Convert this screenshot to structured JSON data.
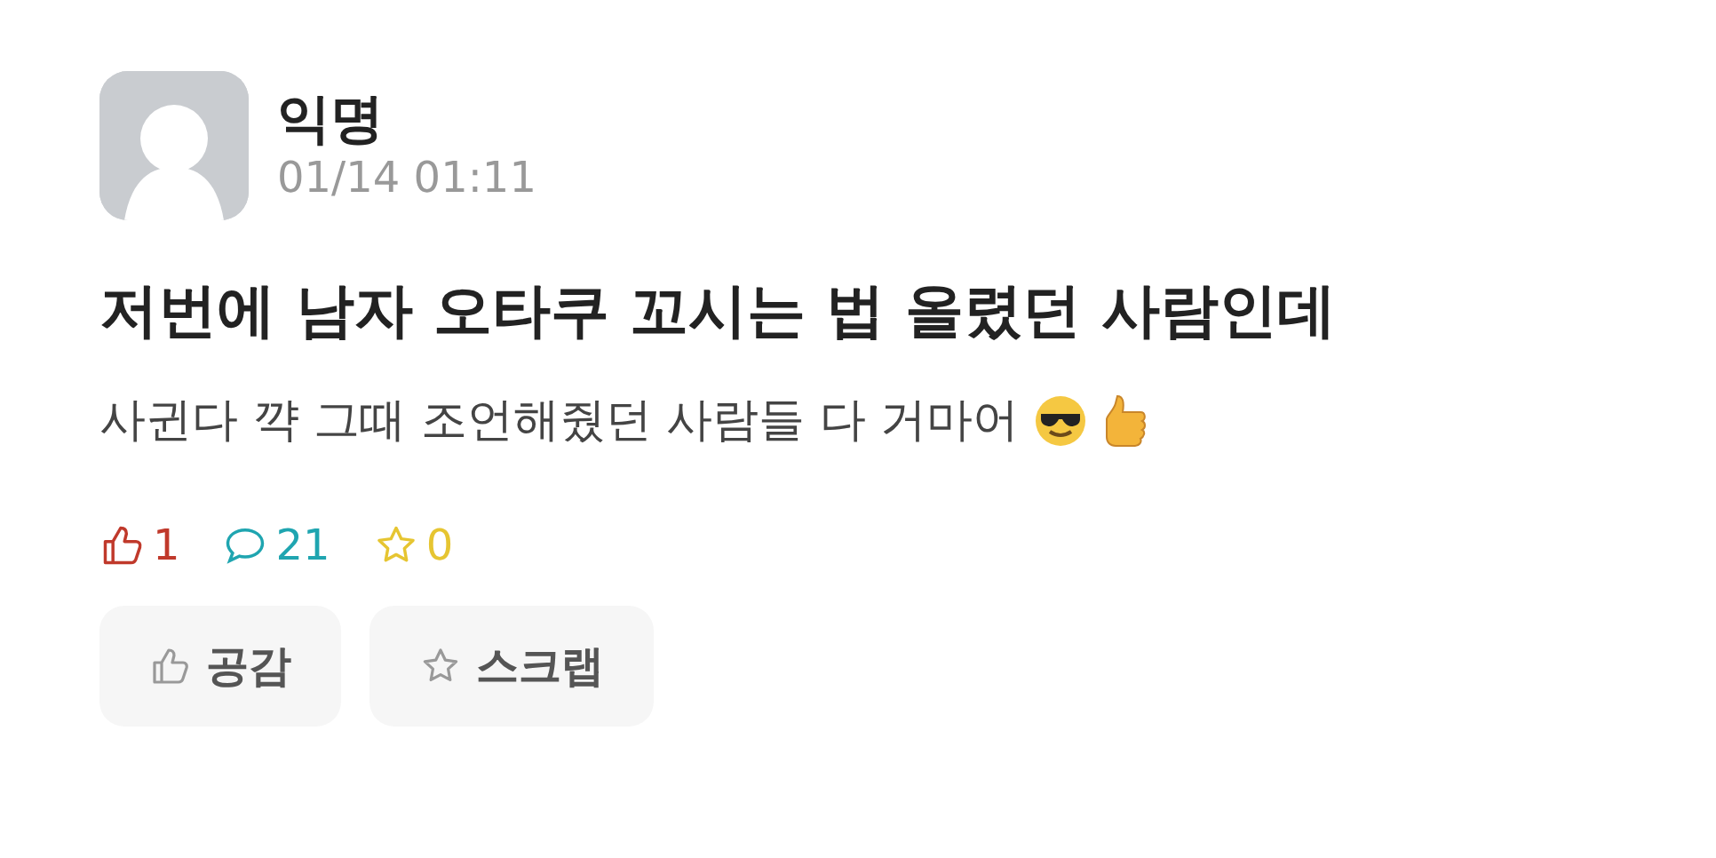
{
  "post": {
    "author": "익명",
    "time": "01/14 01:11",
    "title": "저번에 남자 오타쿠 꼬시는 법 올렸던 사람인데",
    "body": "사귄다 꺅 그때 조언해줬던 사람들 다 거마어"
  },
  "stats": [
    {
      "kind": "like",
      "count": "1",
      "color": "#c0392b"
    },
    {
      "kind": "comment",
      "count": "21",
      "color": "#1fa5b0"
    },
    {
      "kind": "scrap",
      "count": "0",
      "color": "#e6c531"
    }
  ],
  "buttons": [
    {
      "kind": "like",
      "label": "공감"
    },
    {
      "kind": "scrap",
      "label": "스크랩"
    }
  ]
}
